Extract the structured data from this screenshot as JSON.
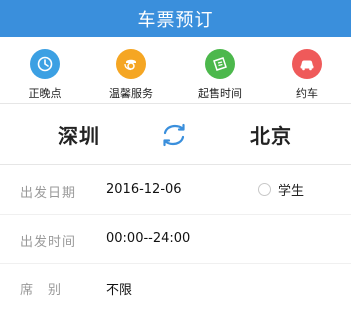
{
  "header": {
    "title": "车票预订"
  },
  "quick_nav": [
    {
      "label": "正晚点",
      "icon": "clock-icon",
      "color": "#3ca0e3"
    },
    {
      "label": "温馨服务",
      "icon": "service-icon",
      "color": "#f5a623"
    },
    {
      "label": "起售时间",
      "icon": "ticket-icon",
      "color": "#4cb84c"
    },
    {
      "label": "约车",
      "icon": "car-icon",
      "color": "#ef5a5a"
    }
  ],
  "route": {
    "from": "深圳",
    "to": "北京",
    "swap_icon": "swap-icon",
    "swap_color": "#3a8fdc"
  },
  "form": {
    "date_label": "出发日期",
    "date_value": "2016-12-06",
    "student_label": "学生",
    "time_label": "出发时间",
    "time_value": "00:00--24:00",
    "seat_label": "席　别",
    "seat_value": "不限"
  }
}
